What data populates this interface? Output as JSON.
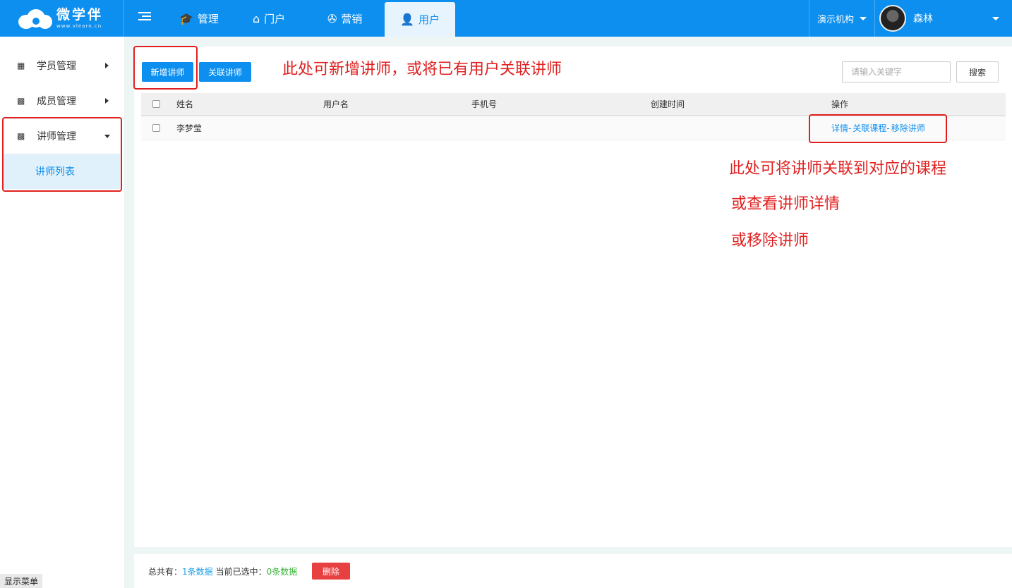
{
  "brand": {
    "name": "微学伴",
    "url": "www.vlearn.cn"
  },
  "nav": {
    "manage": "管理",
    "portal": "门户",
    "marketing": "营销",
    "user": "用户"
  },
  "header": {
    "org": "演示机构",
    "username": "森林"
  },
  "sidebar": {
    "items": [
      {
        "label": "学员管理"
      },
      {
        "label": "成员管理"
      },
      {
        "label": "讲师管理"
      }
    ],
    "sub_item": "讲师列表",
    "show_menu": "显示菜单"
  },
  "toolbar": {
    "add_label": "新增讲师",
    "link_label": "关联讲师",
    "search_placeholder": "请输入关键字",
    "search_label": "搜索"
  },
  "table": {
    "columns": [
      "姓名",
      "用户名",
      "手机号",
      "创建时间",
      "操作"
    ],
    "rows": [
      {
        "name": "李梦莹",
        "username": "",
        "phone": "",
        "created": ""
      }
    ],
    "ops": {
      "detail": "详情",
      "link_course": "关联课程",
      "remove": "移除讲师",
      "sep": "-"
    }
  },
  "annotations": {
    "top": "此处可新增讲师，或将已有用户关联讲师",
    "line1": "此处可将讲师关联到对应的课程",
    "line2": "或查看讲师详情",
    "line3": "或移除讲师"
  },
  "footer": {
    "total_label": "总共有：",
    "total_count": "1条数据",
    "selected_label": "当前已选中：",
    "selected_count": "0条数据",
    "delete_label": "删除"
  },
  "colors": {
    "primary": "#0d8ff0",
    "annotation": "#e02020",
    "danger": "#e84040"
  }
}
